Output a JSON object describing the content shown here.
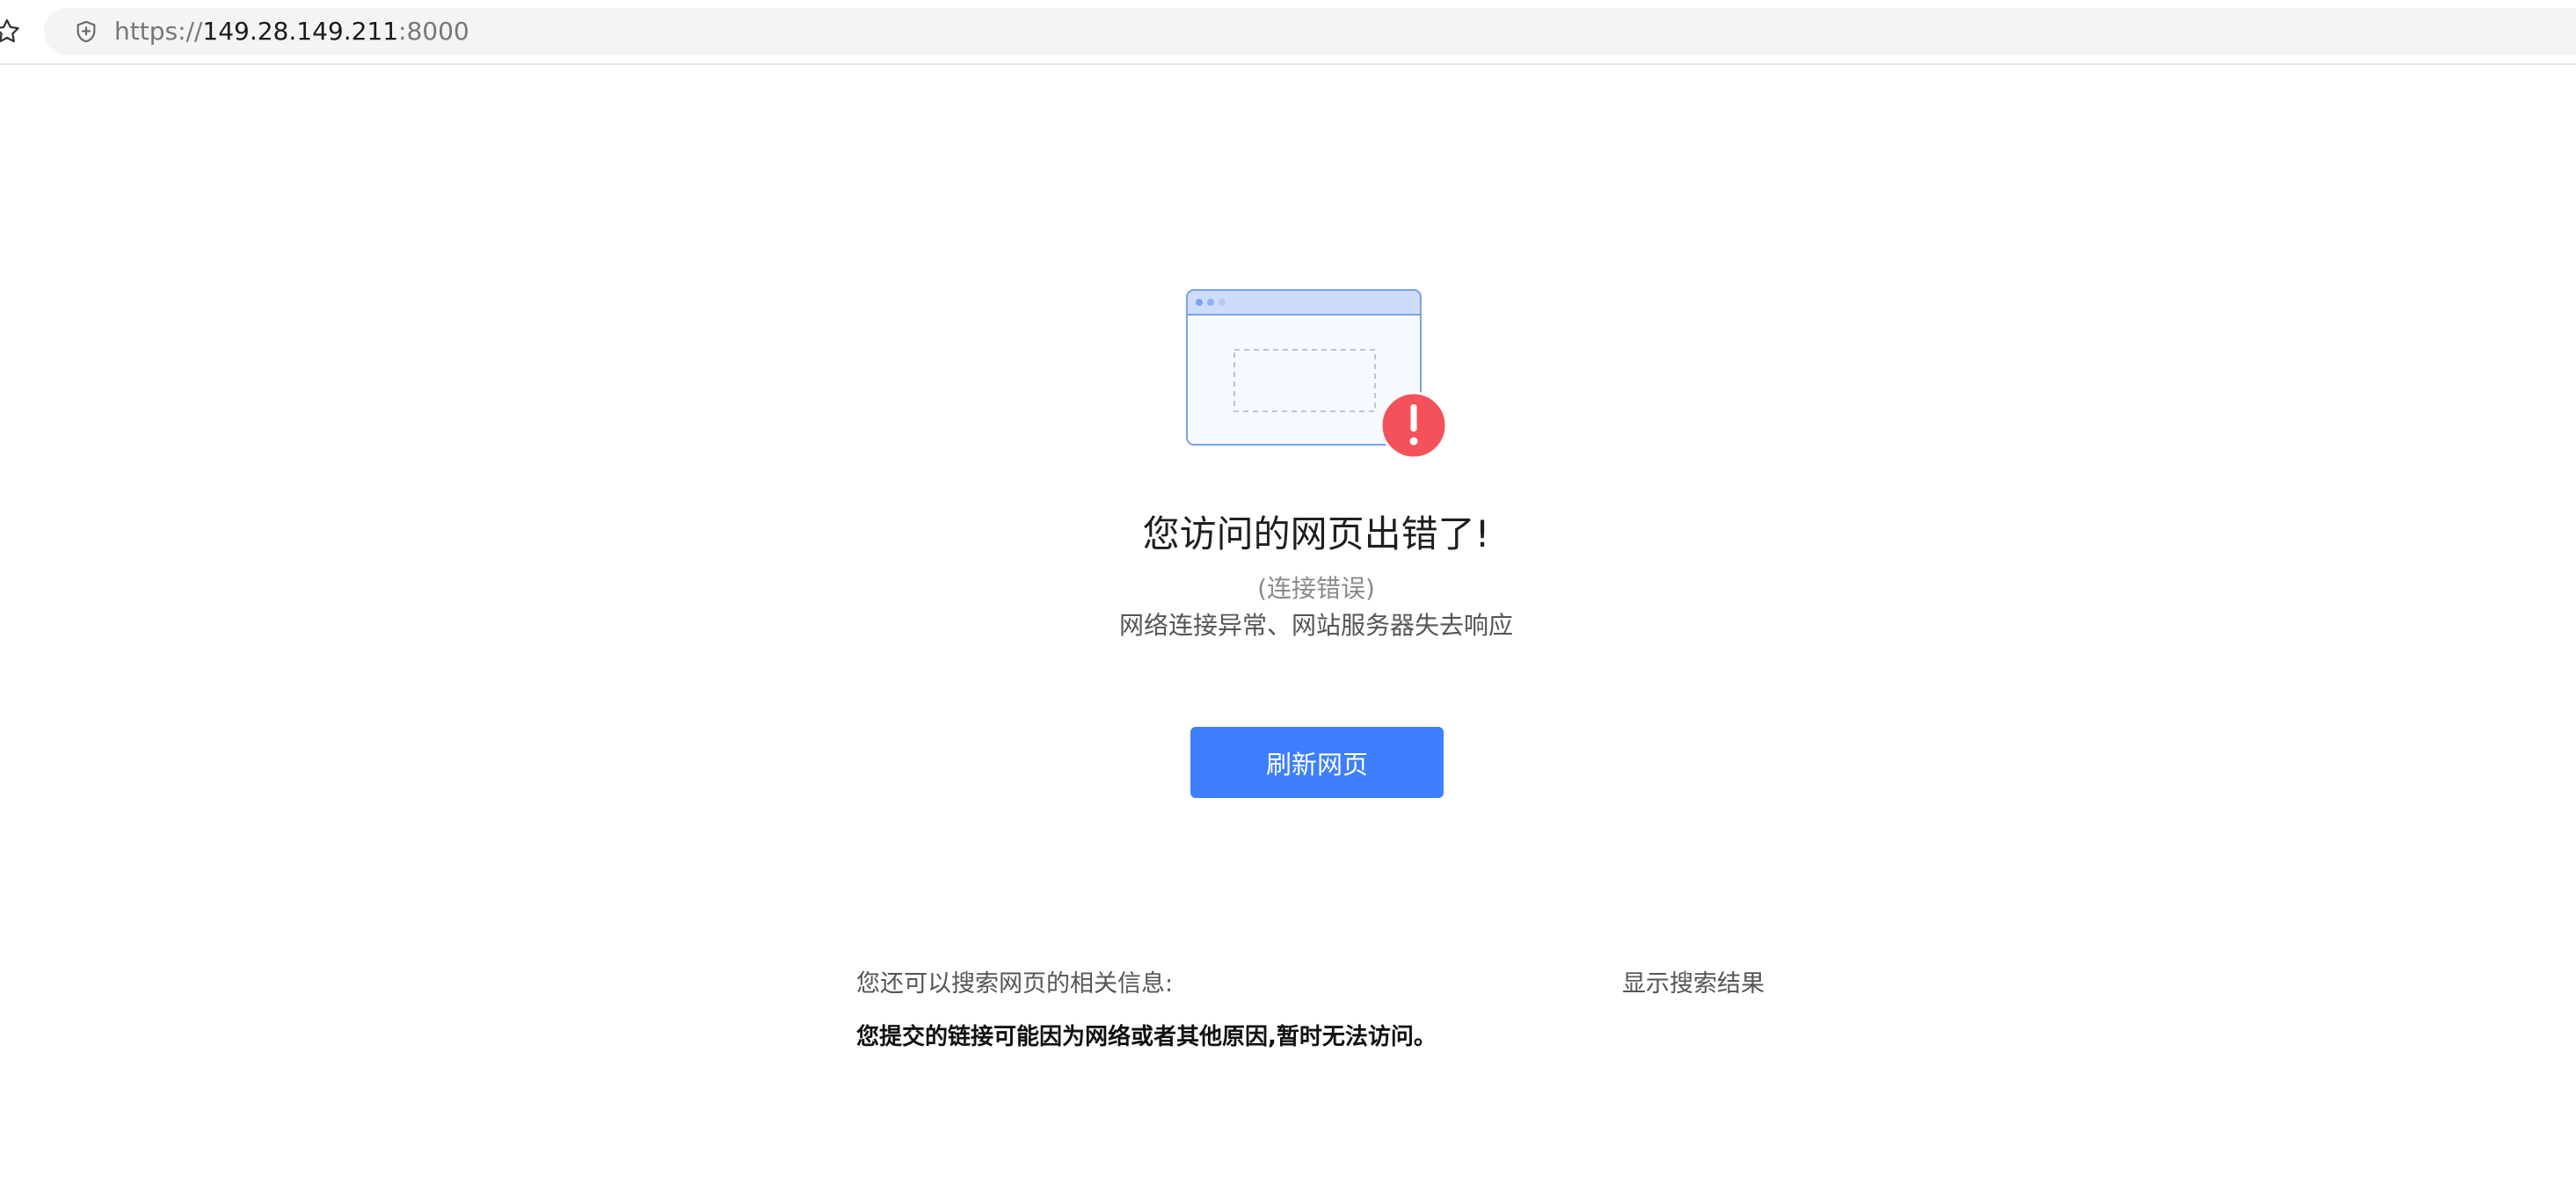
{
  "browser": {
    "url_scheme": "https://",
    "url_host": "149.28.149.211",
    "url_port": ":8000",
    "icons": {
      "bookmark": "star-outline-icon",
      "site_security": "shield-plus-icon"
    }
  },
  "error_page": {
    "title": "您访问的网页出错了!",
    "subtitle": "(连接错误)",
    "description": "网络连接异常、网站服务器失去响应",
    "refresh_button_label": "刷新网页",
    "illustration_icon": "browser-window-error-icon",
    "alert_icon": "exclamation-icon"
  },
  "search_section": {
    "hint": "您还可以搜索网页的相关信息:",
    "show_results_label": "显示搜索结果",
    "result_text": "您提交的链接可能因为网络或者其他原因,暂时无法访问。"
  },
  "colors": {
    "accent_blue": "#3d7ffc",
    "alert_red": "#f4525b",
    "window_border": "#7aa3ee",
    "window_header": "#cddcfb"
  }
}
